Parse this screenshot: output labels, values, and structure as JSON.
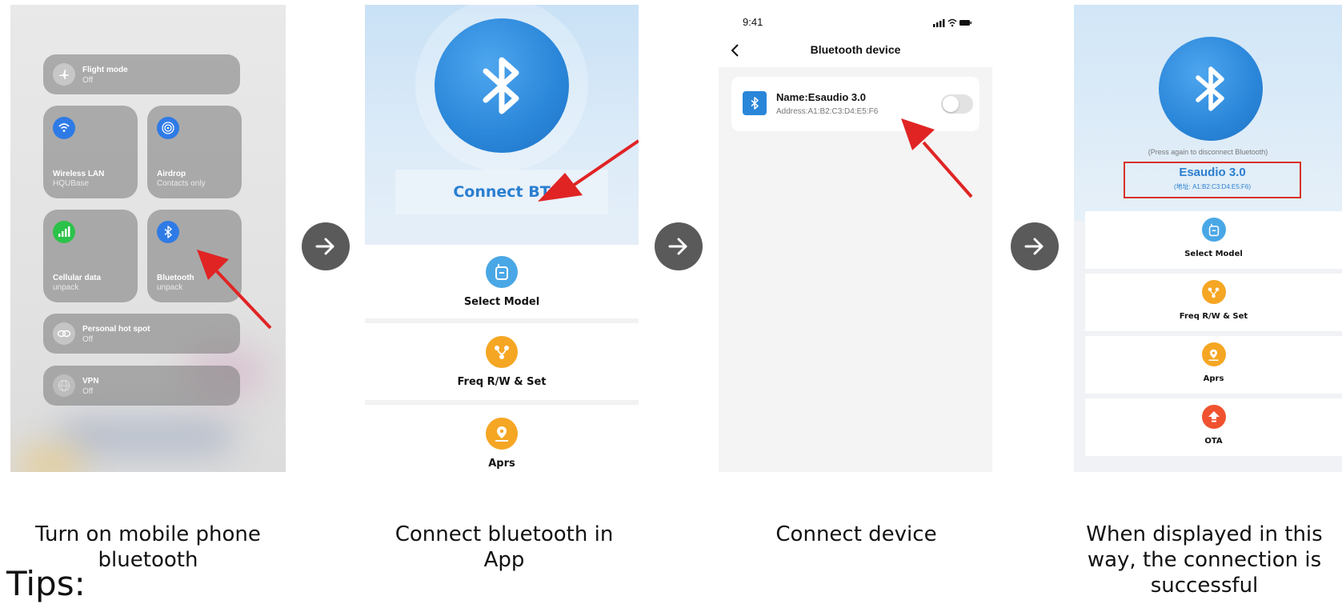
{
  "panel1": {
    "tiles": {
      "flight": {
        "title": "Flight mode",
        "sub": "Off"
      },
      "wlan": {
        "title": "Wireless LAN",
        "sub": "HQUBase"
      },
      "airdrop": {
        "title": "Airdrop",
        "sub": "Contacts only"
      },
      "cellular": {
        "title": "Cellular data",
        "sub": "unpack"
      },
      "bluetooth": {
        "title": "Bluetooth",
        "sub": "unpack"
      },
      "hotspot": {
        "title": "Personal hot spot",
        "sub": "Off"
      },
      "vpn": {
        "title": "VPN",
        "sub": "Off"
      }
    }
  },
  "panel2": {
    "connect_label": "Connect BT",
    "menu": [
      {
        "label": "Select Model",
        "icon": "radio-icon",
        "color": "#4aa7e6"
      },
      {
        "label": "Freq R/W & Set",
        "icon": "share-icon",
        "color": "#f5a623"
      },
      {
        "label": "Aprs",
        "icon": "map-pin-icon",
        "color": "#f5a623"
      }
    ]
  },
  "panel3": {
    "status_time": "9:41",
    "nav_title": "Bluetooth device",
    "device_name": "Name:Esaudio 3.0",
    "device_address": "Address:A1:B2:C3:D4:E5:F6"
  },
  "panel4": {
    "hint": "(Press again to disconnect Bluetooth)",
    "device_name": "Esaudio 3.0",
    "device_address": "(地址: A1:B2:C3:D4:E5:F6)",
    "menu": [
      {
        "label": "Select Model",
        "icon": "radio-icon",
        "color": "#4aa7e6"
      },
      {
        "label": "Freq R/W & Set",
        "icon": "share-icon",
        "color": "#f5a623"
      },
      {
        "label": "Aprs",
        "icon": "map-pin-icon",
        "color": "#f5a623"
      },
      {
        "label": "OTA",
        "icon": "upload-icon",
        "color": "#f0522f"
      }
    ]
  },
  "captions": {
    "step1": "Turn on mobile phone bluetooth",
    "step2": "Connect bluetooth in App",
    "step3": "Connect device",
    "step4": "When displayed in this way, the connection is successful"
  },
  "tips_heading": "Tips:",
  "colors": {
    "bt_blue": "#2a86d9",
    "arrow_red": "#e02424",
    "step_circle": "#5a5a5a"
  }
}
